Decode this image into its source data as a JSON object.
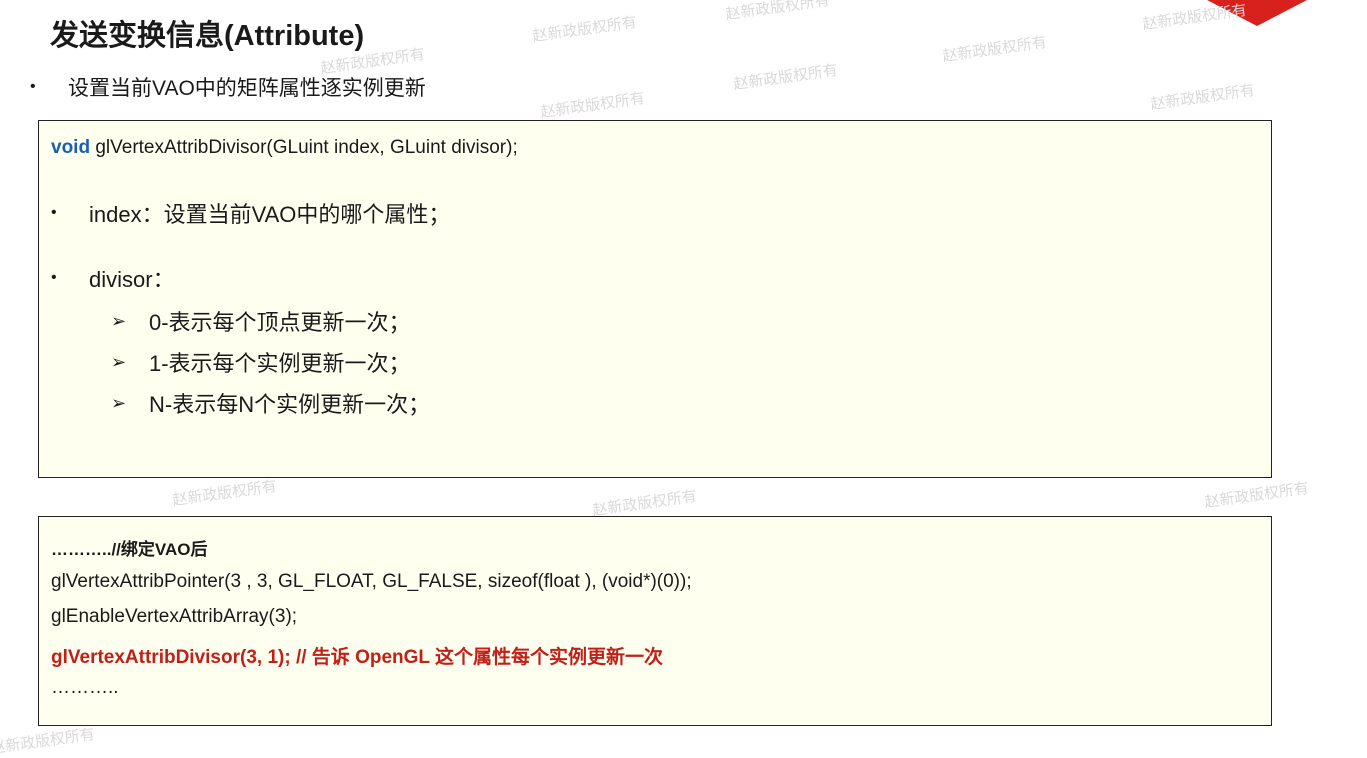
{
  "watermark_text": "赵新政版权所有",
  "title": "发送变换信息(Attribute)",
  "intro": {
    "bullet": "•",
    "text": "设置当前VAO中的矩阵属性逐实例更新"
  },
  "signature_box": {
    "keyword": "void",
    "rest": " glVertexAttribDivisor(GLuint index, GLuint divisor);",
    "params": [
      {
        "bullet": "•",
        "text": "index：设置当前VAO中的哪个属性；"
      },
      {
        "bullet": "•",
        "text": "divisor："
      }
    ],
    "sub_items": [
      {
        "arrow": "➢",
        "text": "0-表示每个顶点更新一次；"
      },
      {
        "arrow": "➢",
        "text": "1-表示每个实例更新一次；"
      },
      {
        "arrow": "➢",
        "text": "N-表示每N个实例更新一次；"
      }
    ]
  },
  "code_box": {
    "lines": [
      "………..//绑定VAO后",
      "glVertexAttribPointer(3 , 3, GL_FLOAT, GL_FALSE, sizeof(float ), (void*)(0));",
      "glEnableVertexAttribArray(3);",
      "glVertexAttribDivisor(3, 1); // 告诉 OpenGL 这个属性每个实例更新一次",
      "……….."
    ]
  },
  "colors": {
    "accent_red": "#d8211c",
    "keyword_blue": "#1a5fb4",
    "highlight_red": "#c0201a",
    "box_background": "#fffff0"
  }
}
